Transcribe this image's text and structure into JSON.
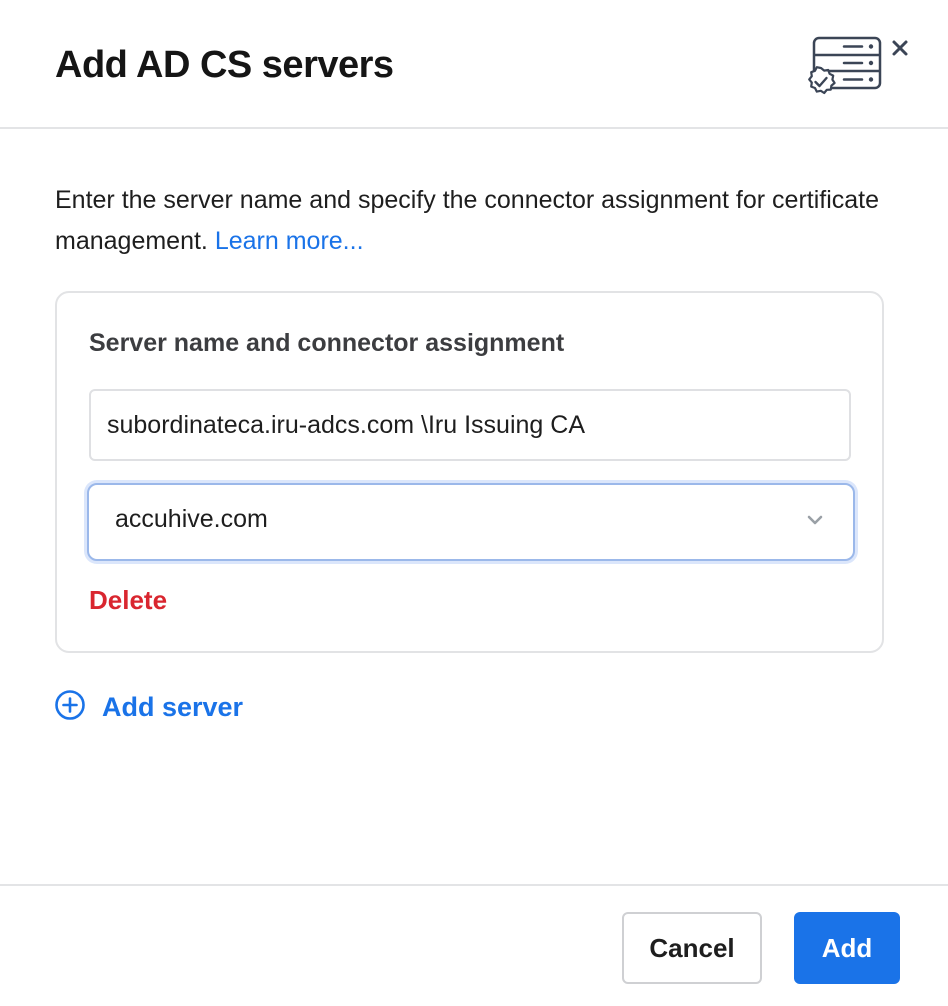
{
  "dialog": {
    "title": "Add AD CS servers",
    "header_icon": "server-certificate-icon",
    "close_icon": "close-icon"
  },
  "description": {
    "text": "Enter the server name and specify the connector assignment for certificate management. ",
    "link_text": "Learn more..."
  },
  "server_card": {
    "label": "Server name and connector assignment",
    "server_name_value": "subordinateca.iru-adcs.com \\Iru Issuing CA",
    "connector_selected": "accuhive.com",
    "chevron_icon": "chevron-down-icon",
    "delete_label": "Delete"
  },
  "add_server": {
    "icon": "plus-circle-icon",
    "label": "Add server"
  },
  "footer": {
    "cancel_label": "Cancel",
    "add_label": "Add"
  },
  "colors": {
    "accent": "#1a73e8",
    "danger": "#d9262f",
    "focus_ring": "#9bb8ea"
  }
}
